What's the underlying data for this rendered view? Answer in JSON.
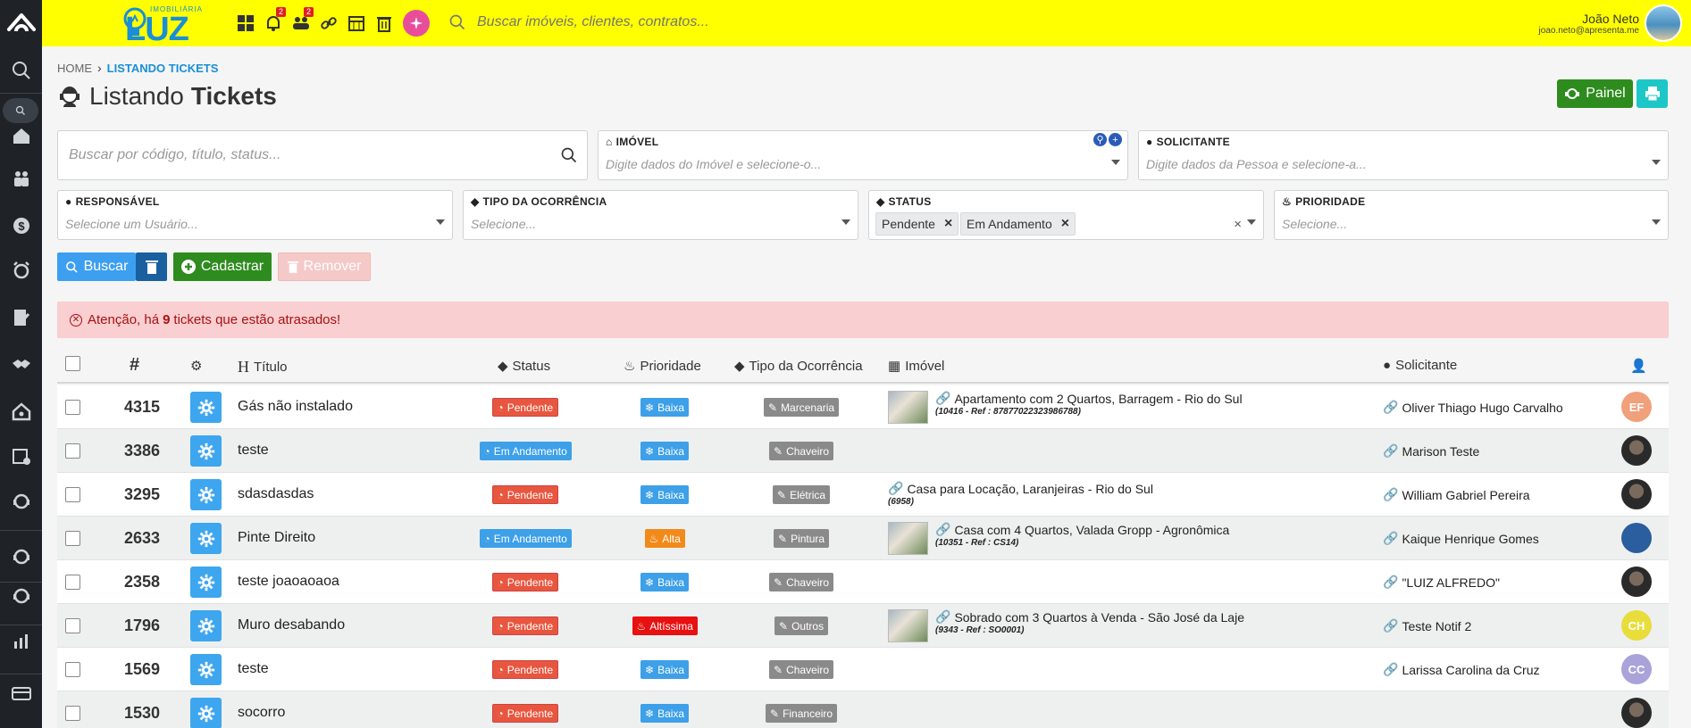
{
  "topbar": {
    "brand_sub": "IMOBILIÁRIA",
    "brand_name": "LUZ",
    "icons": [
      {
        "name": "dashboard-icon",
        "badge": ""
      },
      {
        "name": "bell-icon",
        "badge": "2"
      },
      {
        "name": "users-icon",
        "badge": "2"
      },
      {
        "name": "link-icon",
        "badge": ""
      },
      {
        "name": "calendar-icon",
        "badge": ""
      },
      {
        "name": "trash-icon",
        "badge": ""
      },
      {
        "name": "sparkle-icon",
        "badge": ""
      }
    ],
    "search_placeholder": "Buscar imóveis, clientes, contratos...",
    "user_name": "João Neto",
    "user_email": "joao.neto@apresenta.me"
  },
  "breadcrumb": {
    "home": "HOME",
    "current": "LISTANDO TICKETS"
  },
  "page": {
    "title_light": "Listando",
    "title_bold": "Tickets",
    "painel_label": "Painel"
  },
  "filters": {
    "search_placeholder": "Buscar por código, título, status...",
    "imovel": {
      "label": "IMÓVEL",
      "placeholder": "Digite dados do Imóvel e selecione-o..."
    },
    "solicitante": {
      "label": "SOLICITANTE",
      "placeholder": "Digite dados da Pessoa e selecione-a..."
    },
    "responsavel": {
      "label": "RESPONSÁVEL",
      "placeholder": "Selecione um Usuário..."
    },
    "tipo": {
      "label": "TIPO DA OCORRÊNCIA",
      "placeholder": "Selecione..."
    },
    "status": {
      "label": "STATUS",
      "chips": [
        "Pendente",
        "Em Andamento"
      ]
    },
    "prioridade": {
      "label": "PRIORIDADE",
      "placeholder": "Selecione..."
    }
  },
  "actions": {
    "buscar": "Buscar",
    "cadastrar": "Cadastrar",
    "remover": "Remover"
  },
  "alert": {
    "prefix": "Atenção, há",
    "count": "9",
    "suffix": "tickets que estão atrasados!"
  },
  "table": {
    "headers": {
      "num": "#",
      "titulo": "Título",
      "status": "Status",
      "prioridade": "Prioridade",
      "tipo": "Tipo da Ocorrência",
      "imovel": "Imóvel",
      "solicitante": "Solicitante"
    },
    "rows": [
      {
        "id": "4315",
        "title": "Gás não instalado",
        "status": "Pendente",
        "priority": "Baixa",
        "type": "Marcenaria",
        "imovel": "Apartamento com 2 Quartos, Barragem - Rio do Sul",
        "ref": "(10416 - Ref : 87877022323986788)",
        "solicitante": "Oliver Thiago Hugo Carvalho",
        "avatar": "EF",
        "avatar_color": "#f0a07a"
      },
      {
        "id": "3386",
        "title": "teste",
        "status": "Em Andamento",
        "priority": "Baixa",
        "type": "Chaveiro",
        "imovel": "",
        "ref": "",
        "solicitante": "Marison Teste",
        "avatar": "",
        "avatar_color": ""
      },
      {
        "id": "3295",
        "title": "sdasdasdas",
        "status": "Pendente",
        "priority": "Baixa",
        "type": "Elétrica",
        "imovel": "Casa para Locação, Laranjeiras - Rio do Sul",
        "ref": "(6958)",
        "solicitante": "William Gabriel Pereira",
        "avatar": "",
        "avatar_color": ""
      },
      {
        "id": "2633",
        "title": "Pinte Direito",
        "status": "Em Andamento",
        "priority": "Alta",
        "type": "Pintura",
        "imovel": "Casa com 4 Quartos, Valada Gropp - Agronômica",
        "ref": "(10351 - Ref : CS14)",
        "solicitante": "Kaique Henrique Gomes",
        "avatar": "",
        "avatar_color": ""
      },
      {
        "id": "2358",
        "title": "teste joaoaoaoa",
        "status": "Pendente",
        "priority": "Baixa",
        "type": "Chaveiro",
        "imovel": "",
        "ref": "",
        "solicitante": "\"LUIZ ALFREDO\"",
        "avatar": "",
        "avatar_color": ""
      },
      {
        "id": "1796",
        "title": "Muro desabando",
        "status": "Pendente",
        "priority": "Altíssima",
        "type": "Outros",
        "imovel": "Sobrado com 3 Quartos à Venda - São José da Laje",
        "ref": "(9343 - Ref : SO0001)",
        "solicitante": "Teste Notif 2",
        "avatar": "CH",
        "avatar_color": "#e8dd3a"
      },
      {
        "id": "1569",
        "title": "teste",
        "status": "Pendente",
        "priority": "Baixa",
        "type": "Chaveiro",
        "imovel": "",
        "ref": "",
        "solicitante": "Larissa Carolina da Cruz",
        "avatar": "CC",
        "avatar_color": "#a9a3da"
      },
      {
        "id": "1530",
        "title": "socorro",
        "status": "Pendente",
        "priority": "Baixa",
        "type": "Financeiro",
        "imovel": "",
        "ref": "",
        "solicitante": "",
        "avatar": "",
        "avatar_color": ""
      }
    ]
  }
}
